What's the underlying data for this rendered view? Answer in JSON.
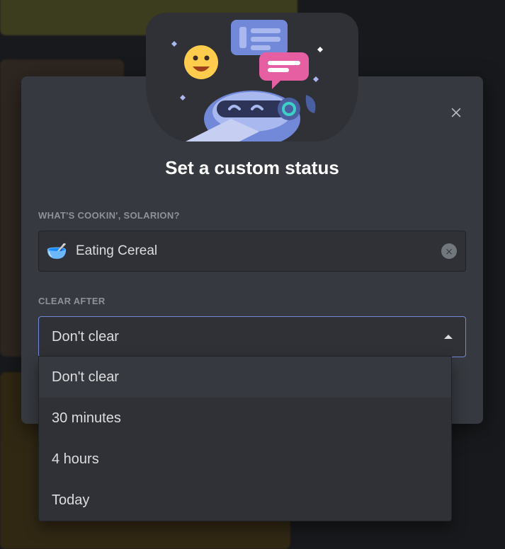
{
  "modal": {
    "title": "Set a custom status",
    "prompt_label": "WHAT'S COOKIN', SOLARION?",
    "status": {
      "emoji": "🥣",
      "value": "Eating Cereal"
    },
    "clear_after_label": "CLEAR AFTER",
    "clear_after_selected": "Don't clear",
    "clear_after_options": [
      "Don't clear",
      "30 minutes",
      "4 hours",
      "Today"
    ]
  }
}
